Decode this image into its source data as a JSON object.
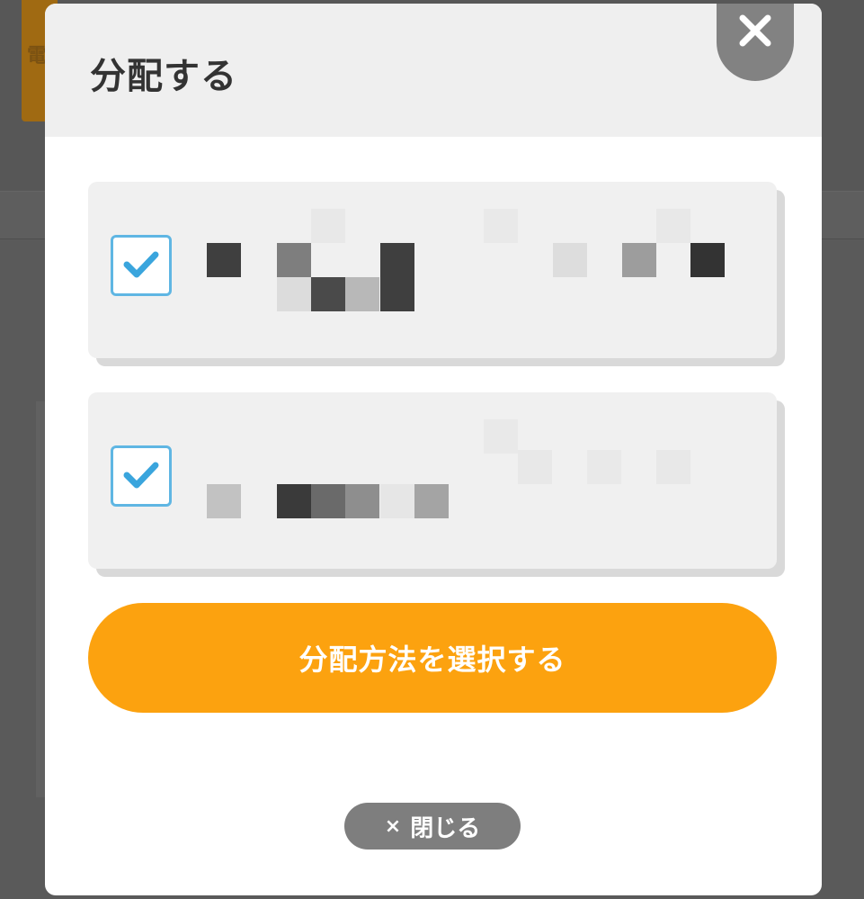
{
  "dialog": {
    "title": "分配する",
    "primary_button_label": "分配方法を選択する",
    "close_button_label": "閉じる",
    "close_symbol": "×"
  },
  "options": [
    {
      "checked": true,
      "label_obscured": true
    },
    {
      "checked": true,
      "label_obscured": true
    }
  ],
  "background": {
    "card_label": "電"
  },
  "colors": {
    "accent": "#fca20f",
    "checkbox_border": "#5fb6e3",
    "check_mark": "#3aa5dd",
    "header_bg": "#efefef",
    "card_bg": "#f0f0f0",
    "close_button_bg": "#828282",
    "overlay": "#595959"
  },
  "icons": {
    "close": "close-icon",
    "check": "check-icon"
  }
}
